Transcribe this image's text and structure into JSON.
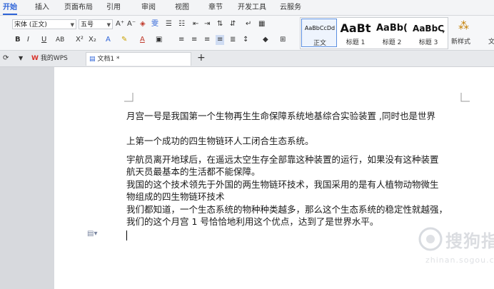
{
  "menubar": {
    "tabs": [
      "开始",
      "插入",
      "页面布局",
      "引用",
      "审阅",
      "视图",
      "章节",
      "开发工具",
      "云服务"
    ],
    "active": "开始"
  },
  "ribbon": {
    "font_name": "宋体 (正文)",
    "font_size": "五号",
    "styles": [
      {
        "sample": "AaBbCcDd",
        "name": "正文"
      },
      {
        "sample": "AaBt",
        "name": "标题 1"
      },
      {
        "sample": "AaBb(",
        "name": "标题 2"
      },
      {
        "sample": "AaBbC",
        "name": "标题 3"
      }
    ],
    "new_style_label": "新样式",
    "more_label": "文"
  },
  "tabs": {
    "home_tab": "我的WPS",
    "doc_tab": "文档1 *",
    "add_label": "+"
  },
  "document": {
    "paragraphs": [
      "月宫一号是我国第一个生物再生生命保障系统地基综合实验装置 ,同时也是世界",
      "上第一个成功的四生物链环人工闭合生态系统。",
      "宇航员离开地球后，在遥远太空生存全部靠这种装置的运行，如果没有这种装置",
      "航天员最基本的生活都不能保障。",
      "我国的这个技术领先于外国的两生物链环技术，我国采用的是有人植物动物微生",
      "物组成的四生物链环技术",
      "我们都知道，一个生态系统的物种种类越多，那么这个生态系统的稳定性就越强，",
      "我们的这个月宫 1 号恰恰地利用这个优点，达到了是世界水平。"
    ]
  },
  "watermark": {
    "text": "搜狗指南",
    "url": "zhinan.sogou.com"
  }
}
